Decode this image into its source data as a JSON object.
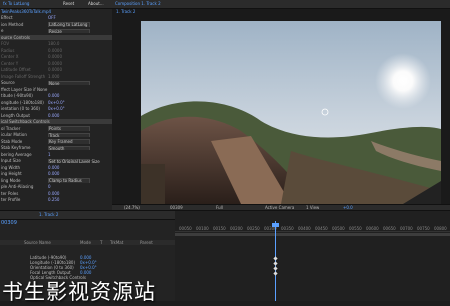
{
  "effect_controls": {
    "tabs": [
      "fx To LatLong",
      "Reset",
      "About..."
    ],
    "path": "TwinPeaks360ToTalk.mp4",
    "rows": [
      {
        "label": "Effect",
        "value": "OFF"
      },
      {
        "label": "ion Method",
        "value": "LatLong to LatLong"
      },
      {
        "label": "e",
        "value": "Resize"
      },
      {
        "label": "ource Controls",
        "value": ""
      },
      {
        "label": "FOV",
        "value": "180.0"
      },
      {
        "label": "Radius",
        "value": "0.0000"
      },
      {
        "label": "Center X",
        "value": "0.0000"
      },
      {
        "label": "Center Y",
        "value": "0.0000"
      },
      {
        "label": "Latitude Offset",
        "value": "0.0000"
      },
      {
        "label": "Image Falloff Strength",
        "value": "1.000"
      },
      {
        "label": "Source",
        "value": "None"
      },
      {
        "label": "ffect Layer Size if None",
        "value": ""
      },
      {
        "label": "titude (-90to90)",
        "value": "0.000"
      },
      {
        "label": "ongitude (-180to180)",
        "value": "0x+0.0°"
      },
      {
        "label": "ientation (0 to 360)",
        "value": "0x+0.0°"
      },
      {
        "label": "Length Output",
        "value": "0.000"
      },
      {
        "label": "ical Switchback Controls",
        "value": ""
      },
      {
        "label": "ol Tracker",
        "value": "Points"
      },
      {
        "label": "icular Motion",
        "value": "Track"
      },
      {
        "label": "Stab Mode",
        "value": "Key Framed"
      },
      {
        "label": "Stab Keyframe",
        "value": "Smooth"
      },
      {
        "label": "bering Average",
        "value": "1"
      },
      {
        "label": "Input Size",
        "value": "Set to Original Layer Size"
      },
      {
        "label": "ing Width",
        "value": "0.000"
      },
      {
        "label": "ing Height",
        "value": "0.000"
      },
      {
        "label": "ling Mode",
        "value": "Clamp to Radius"
      },
      {
        "label": "ple Anti-Aliasing",
        "value": "0"
      },
      {
        "label": "ter Poles",
        "value": "0.000"
      },
      {
        "label": "ter Profile",
        "value": "0.250"
      }
    ]
  },
  "viewer": {
    "tabs": [
      "Composition 1. Track 2",
      "≡"
    ],
    "comp_label": "1. Track 2",
    "zoom": "(24.7%)",
    "timecode": "00309",
    "quality": "Full",
    "camera": "Active Camera",
    "views": "1 View",
    "exposure": "+0.0"
  },
  "timeline": {
    "tab": "1. Track 2",
    "timecode": "00309",
    "columns": [
      "Source Name",
      "Mode",
      "T",
      "TrkMat",
      "Parent"
    ],
    "rows": [
      {
        "label": "Latitude (-90to90)",
        "value": "0.000"
      },
      {
        "label": "Longitude (-180to180)",
        "value": "0x+0.0°"
      },
      {
        "label": "Orientation (0 to 360)",
        "value": "0x+0.0°"
      },
      {
        "label": "Focal Length Output",
        "value": "0.000"
      },
      {
        "label": "Optical Switchback Controls",
        "value": ""
      }
    ],
    "ruler": [
      "00050",
      "00100",
      "00150",
      "00200",
      "00250",
      "00300",
      "00350",
      "00400",
      "00450",
      "00500",
      "00550",
      "00600",
      "00650",
      "00700",
      "00750",
      "00800"
    ]
  },
  "watermark": "书生影视资源站"
}
